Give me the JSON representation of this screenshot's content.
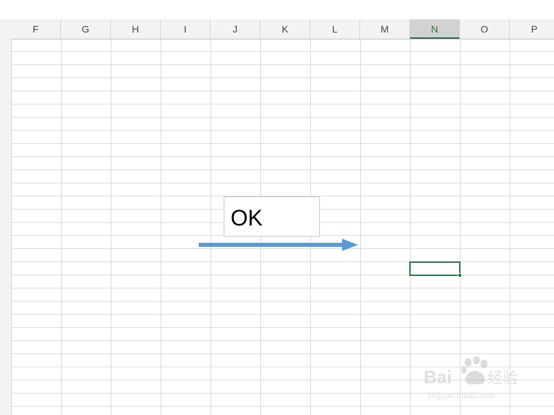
{
  "columns": [
    {
      "label": "F"
    },
    {
      "label": "G"
    },
    {
      "label": "H"
    },
    {
      "label": "I"
    },
    {
      "label": "J"
    },
    {
      "label": "K"
    },
    {
      "label": "L"
    },
    {
      "label": "M"
    },
    {
      "label": "N"
    },
    {
      "label": "O"
    },
    {
      "label": "P"
    }
  ],
  "selected_column": "N",
  "textbox": {
    "text": "OK"
  },
  "arrow": {
    "color": "#5b9bd5",
    "direction": "right"
  },
  "active_cell": {
    "column": "N",
    "color": "#217346"
  },
  "watermark": {
    "brand": "Baidu",
    "cn": "经验",
    "url": "jingyan.baidu.com"
  },
  "colors": {
    "accent": "#217346",
    "gridline": "#d9d9d9",
    "header_bg": "#f3f3f3"
  }
}
